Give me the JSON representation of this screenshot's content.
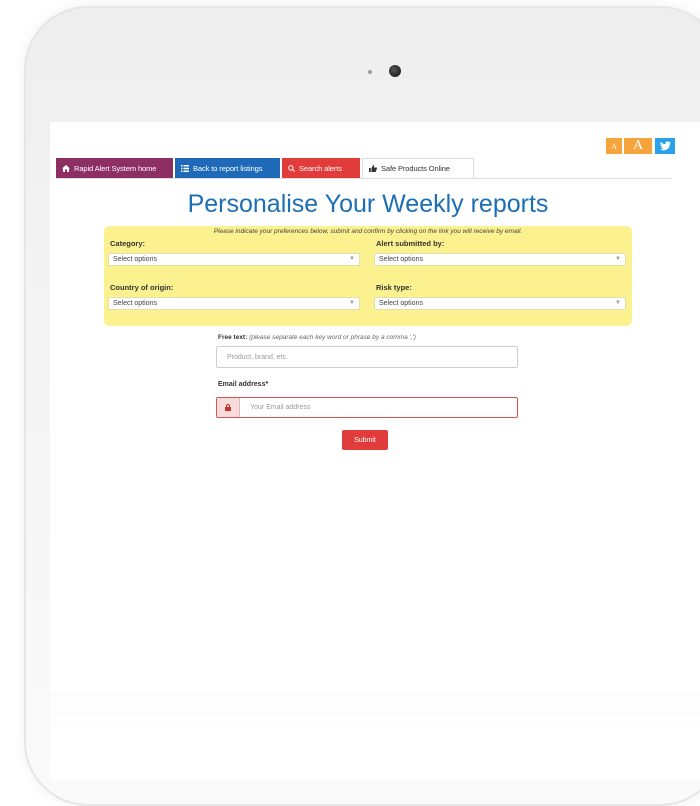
{
  "utility": {
    "font_small": "A",
    "font_large": "A",
    "twitter_icon": "twitter-icon"
  },
  "nav": {
    "tabs": [
      {
        "label": "Rapid Alert System home",
        "icon": "home-icon",
        "color": "#8e2f63"
      },
      {
        "label": "Back to report listings",
        "icon": "list-icon",
        "color": "#1f6ab8"
      },
      {
        "label": "Search alerts",
        "icon": "search-icon",
        "color": "#e23b3b"
      },
      {
        "label": "Safe Products Online",
        "icon": "thumbs-up-icon",
        "color": "#ffffff"
      }
    ]
  },
  "page": {
    "title": "Personalise Your Weekly reports",
    "intro": "Please indicate your preferences below, submit and confirm by clicking on the link you will receive by email."
  },
  "form": {
    "category": {
      "label": "Category:",
      "value": "Select options"
    },
    "alert_submitted_by": {
      "label": "Alert submitted by:",
      "value": "Select options"
    },
    "country_of_origin": {
      "label": "Country of origin:",
      "value": "Select options"
    },
    "risk_type": {
      "label": "Risk type:",
      "value": "Select options"
    },
    "free_text": {
      "label": "Free text:",
      "hint": "(please separate each key word or phrase by a comma ',')",
      "placeholder": "Product, brand, etc."
    },
    "email": {
      "label": "Email address*",
      "placeholder": "Your Email address"
    },
    "submit_label": "Submit"
  },
  "colors": {
    "title_blue": "#1c6fb5",
    "prefs_yellow": "#fbf18e",
    "accent_red": "#e23b3b"
  }
}
